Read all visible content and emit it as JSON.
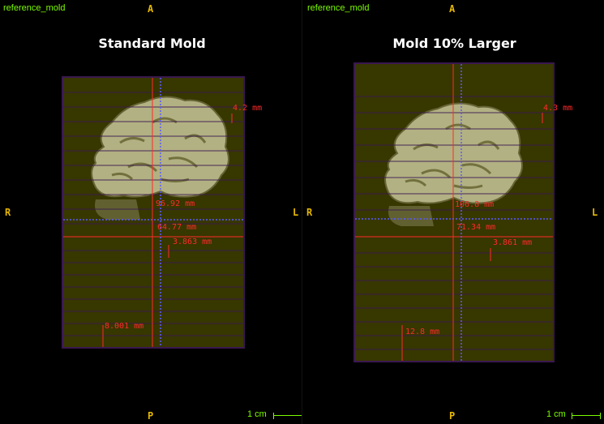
{
  "left": {
    "viewport_label": "reference_mold",
    "title": "Standard Mold",
    "orient": {
      "top": "A",
      "bottom": "P",
      "left": "R",
      "right": "L"
    },
    "measurements": [
      "4.2 mm",
      "96.92 mm",
      "64.77 mm",
      "3.863 mm",
      "8.001 mm"
    ],
    "scale_label": "1 cm"
  },
  "right": {
    "viewport_label": "reference_mold",
    "title": "Mold 10% Larger",
    "orient": {
      "top": "A",
      "bottom": "P",
      "left": "R",
      "right": "L"
    },
    "measurements": [
      "4.3 mm",
      "106.8 mm",
      "71.34 mm",
      "3.861 mm",
      "12.8 mm"
    ],
    "scale_label": "1 cm"
  },
  "colors": {
    "mold_fill": "#646400",
    "mold_border": "#3a1850",
    "measurement": "#ff2a2a",
    "crosshair": "#5a5aff",
    "orientation": "#e6b800",
    "label": "#7CFC00"
  }
}
